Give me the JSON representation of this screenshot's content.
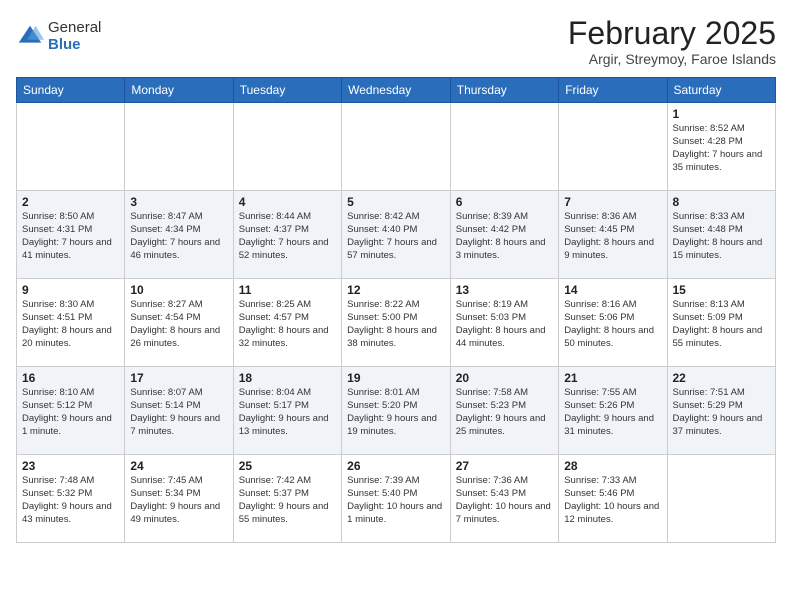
{
  "logo": {
    "general": "General",
    "blue": "Blue"
  },
  "header": {
    "month": "February 2025",
    "location": "Argir, Streymoy, Faroe Islands"
  },
  "weekdays": [
    "Sunday",
    "Monday",
    "Tuesday",
    "Wednesday",
    "Thursday",
    "Friday",
    "Saturday"
  ],
  "weeks": [
    {
      "days": [
        {
          "num": "",
          "info": ""
        },
        {
          "num": "",
          "info": ""
        },
        {
          "num": "",
          "info": ""
        },
        {
          "num": "",
          "info": ""
        },
        {
          "num": "",
          "info": ""
        },
        {
          "num": "",
          "info": ""
        },
        {
          "num": "1",
          "info": "Sunrise: 8:52 AM\nSunset: 4:28 PM\nDaylight: 7 hours and 35 minutes."
        }
      ]
    },
    {
      "days": [
        {
          "num": "2",
          "info": "Sunrise: 8:50 AM\nSunset: 4:31 PM\nDaylight: 7 hours and 41 minutes."
        },
        {
          "num": "3",
          "info": "Sunrise: 8:47 AM\nSunset: 4:34 PM\nDaylight: 7 hours and 46 minutes."
        },
        {
          "num": "4",
          "info": "Sunrise: 8:44 AM\nSunset: 4:37 PM\nDaylight: 7 hours and 52 minutes."
        },
        {
          "num": "5",
          "info": "Sunrise: 8:42 AM\nSunset: 4:40 PM\nDaylight: 7 hours and 57 minutes."
        },
        {
          "num": "6",
          "info": "Sunrise: 8:39 AM\nSunset: 4:42 PM\nDaylight: 8 hours and 3 minutes."
        },
        {
          "num": "7",
          "info": "Sunrise: 8:36 AM\nSunset: 4:45 PM\nDaylight: 8 hours and 9 minutes."
        },
        {
          "num": "8",
          "info": "Sunrise: 8:33 AM\nSunset: 4:48 PM\nDaylight: 8 hours and 15 minutes."
        }
      ]
    },
    {
      "days": [
        {
          "num": "9",
          "info": "Sunrise: 8:30 AM\nSunset: 4:51 PM\nDaylight: 8 hours and 20 minutes."
        },
        {
          "num": "10",
          "info": "Sunrise: 8:27 AM\nSunset: 4:54 PM\nDaylight: 8 hours and 26 minutes."
        },
        {
          "num": "11",
          "info": "Sunrise: 8:25 AM\nSunset: 4:57 PM\nDaylight: 8 hours and 32 minutes."
        },
        {
          "num": "12",
          "info": "Sunrise: 8:22 AM\nSunset: 5:00 PM\nDaylight: 8 hours and 38 minutes."
        },
        {
          "num": "13",
          "info": "Sunrise: 8:19 AM\nSunset: 5:03 PM\nDaylight: 8 hours and 44 minutes."
        },
        {
          "num": "14",
          "info": "Sunrise: 8:16 AM\nSunset: 5:06 PM\nDaylight: 8 hours and 50 minutes."
        },
        {
          "num": "15",
          "info": "Sunrise: 8:13 AM\nSunset: 5:09 PM\nDaylight: 8 hours and 55 minutes."
        }
      ]
    },
    {
      "days": [
        {
          "num": "16",
          "info": "Sunrise: 8:10 AM\nSunset: 5:12 PM\nDaylight: 9 hours and 1 minute."
        },
        {
          "num": "17",
          "info": "Sunrise: 8:07 AM\nSunset: 5:14 PM\nDaylight: 9 hours and 7 minutes."
        },
        {
          "num": "18",
          "info": "Sunrise: 8:04 AM\nSunset: 5:17 PM\nDaylight: 9 hours and 13 minutes."
        },
        {
          "num": "19",
          "info": "Sunrise: 8:01 AM\nSunset: 5:20 PM\nDaylight: 9 hours and 19 minutes."
        },
        {
          "num": "20",
          "info": "Sunrise: 7:58 AM\nSunset: 5:23 PM\nDaylight: 9 hours and 25 minutes."
        },
        {
          "num": "21",
          "info": "Sunrise: 7:55 AM\nSunset: 5:26 PM\nDaylight: 9 hours and 31 minutes."
        },
        {
          "num": "22",
          "info": "Sunrise: 7:51 AM\nSunset: 5:29 PM\nDaylight: 9 hours and 37 minutes."
        }
      ]
    },
    {
      "days": [
        {
          "num": "23",
          "info": "Sunrise: 7:48 AM\nSunset: 5:32 PM\nDaylight: 9 hours and 43 minutes."
        },
        {
          "num": "24",
          "info": "Sunrise: 7:45 AM\nSunset: 5:34 PM\nDaylight: 9 hours and 49 minutes."
        },
        {
          "num": "25",
          "info": "Sunrise: 7:42 AM\nSunset: 5:37 PM\nDaylight: 9 hours and 55 minutes."
        },
        {
          "num": "26",
          "info": "Sunrise: 7:39 AM\nSunset: 5:40 PM\nDaylight: 10 hours and 1 minute."
        },
        {
          "num": "27",
          "info": "Sunrise: 7:36 AM\nSunset: 5:43 PM\nDaylight: 10 hours and 7 minutes."
        },
        {
          "num": "28",
          "info": "Sunrise: 7:33 AM\nSunset: 5:46 PM\nDaylight: 10 hours and 12 minutes."
        },
        {
          "num": "",
          "info": ""
        }
      ]
    }
  ]
}
